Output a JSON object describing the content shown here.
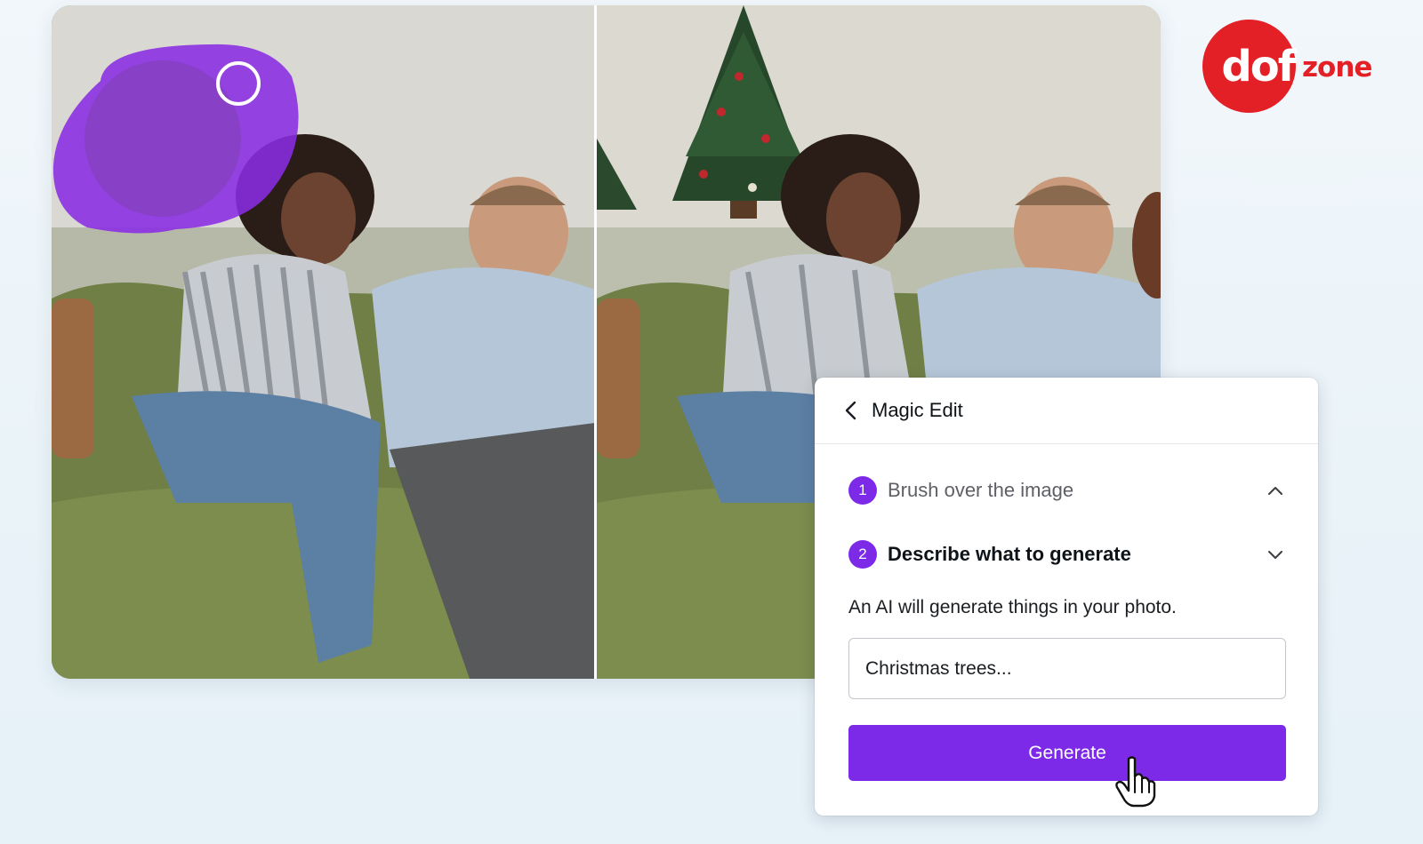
{
  "panel": {
    "title": "Magic Edit",
    "steps": [
      {
        "number": "1",
        "label": "Brush over the image"
      },
      {
        "number": "2",
        "label": "Describe what to generate"
      }
    ],
    "description": "An AI will generate things in your photo.",
    "prompt_value": "Christmas trees...",
    "generate_label": "Generate"
  },
  "logo": {
    "main": "dof",
    "sub": "zone"
  },
  "colors": {
    "accent": "#7d2ae8",
    "logo_red": "#e42027",
    "brush_overlay": "#8a2be2"
  },
  "icons": {
    "back": "chevron-left-icon",
    "step1_toggle": "chevron-up-icon",
    "step2_toggle": "chevron-down-icon",
    "pointer": "hand-cursor-icon",
    "brush": "brush-cursor-icon"
  }
}
